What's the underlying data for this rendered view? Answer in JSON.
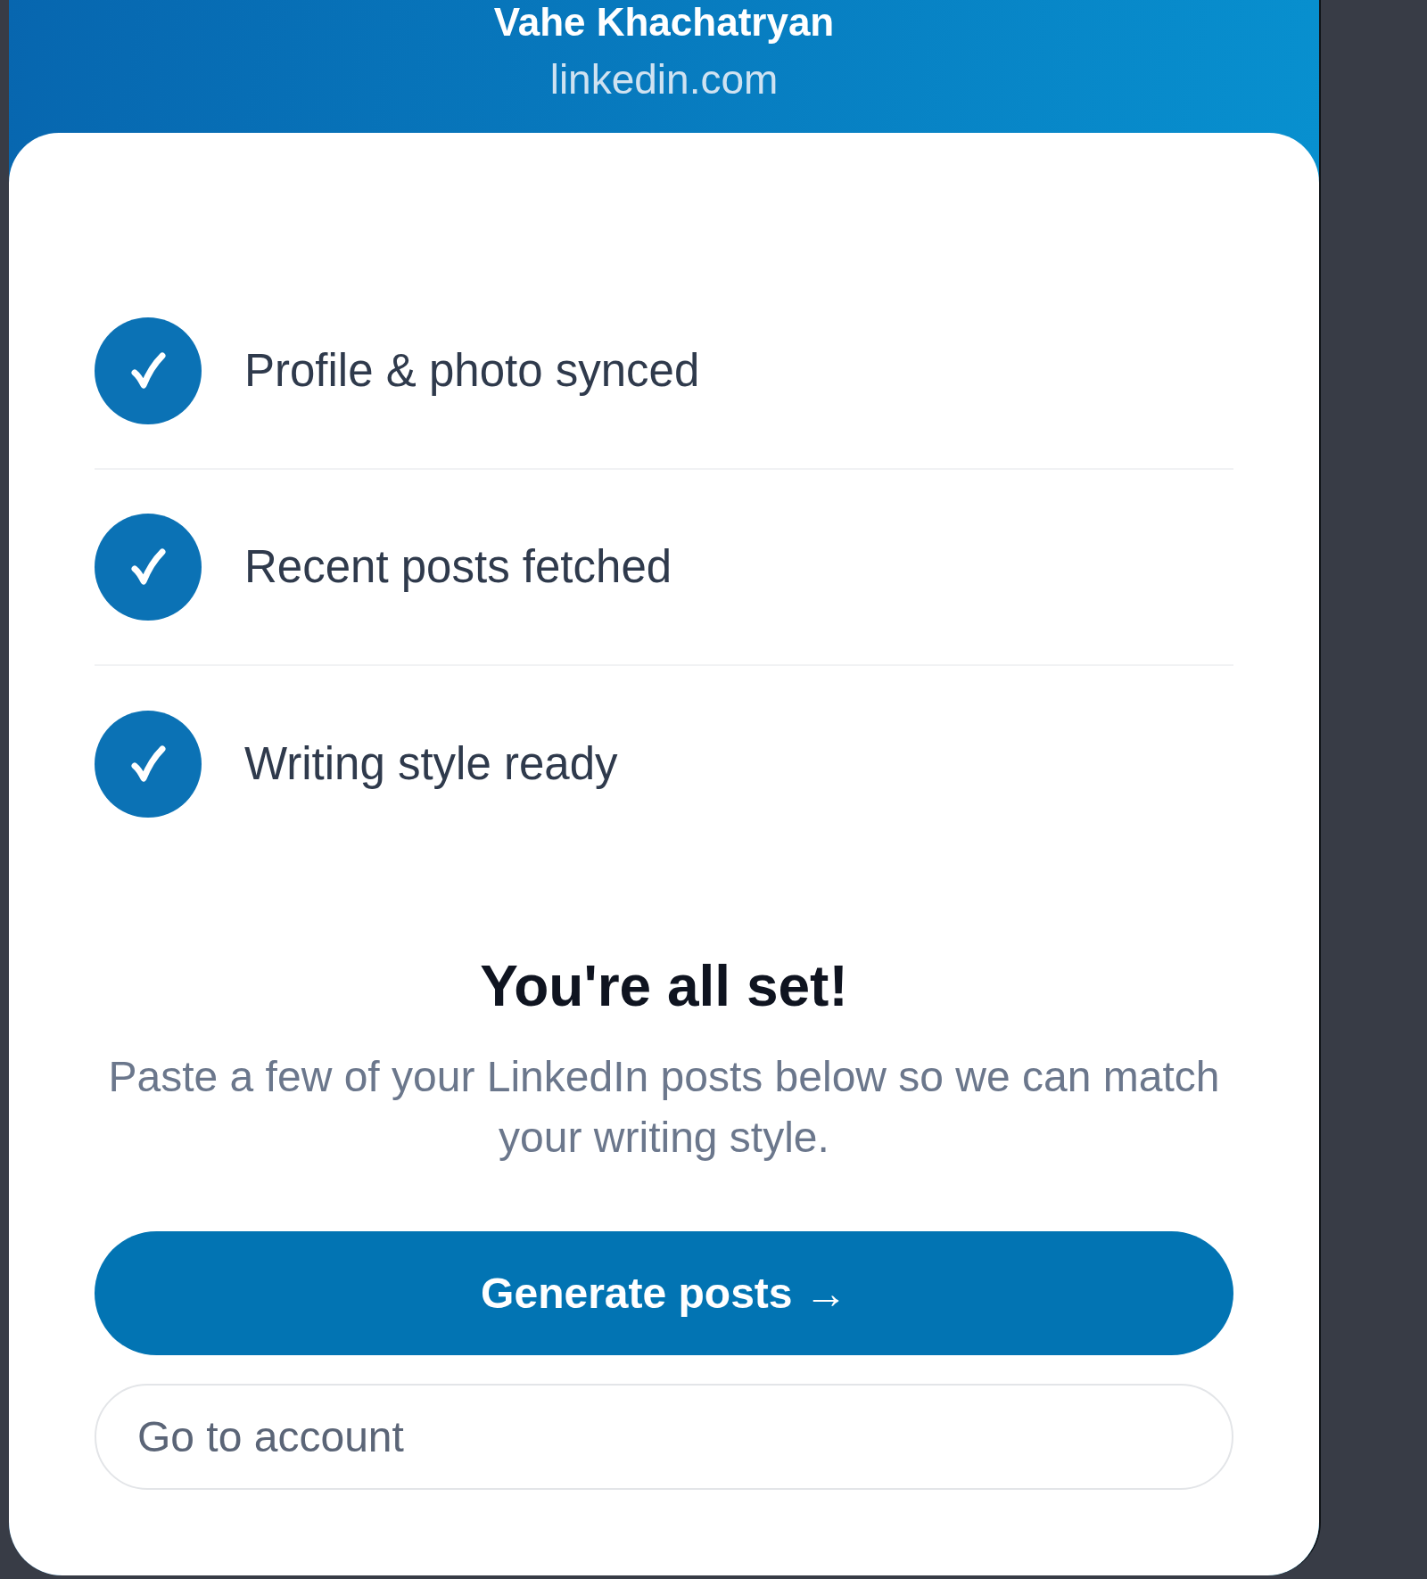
{
  "header": {
    "name": "Vahe Khachatryan",
    "source": "linkedin.com"
  },
  "steps": [
    {
      "label": "Profile & photo synced",
      "checked": true
    },
    {
      "label": "Recent posts fetched",
      "checked": true
    },
    {
      "label": "Writing style ready",
      "checked": true
    }
  ],
  "title": "You're all set!",
  "message": "Paste a few of your LinkedIn posts below so we can match your writing style.",
  "buttons": [
    {
      "label": "Generate posts →",
      "kind": "primary"
    },
    {
      "label": "Go to account",
      "kind": "secondary"
    }
  ]
}
